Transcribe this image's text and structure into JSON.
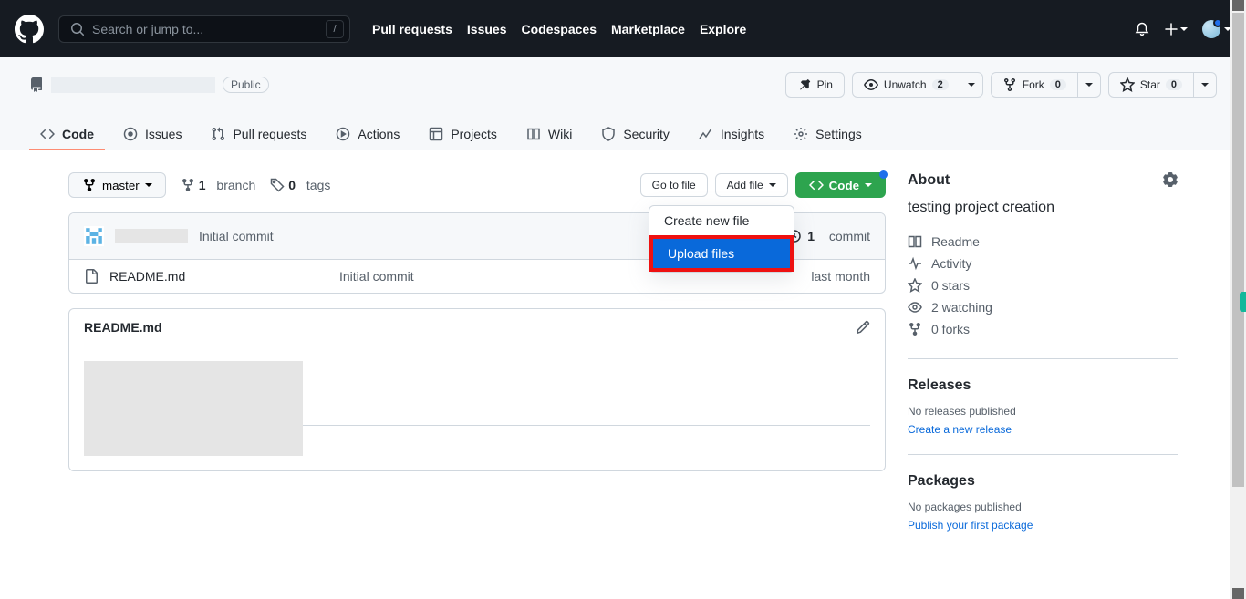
{
  "topbar": {
    "search_placeholder": "Search or jump to...",
    "nav": [
      "Pull requests",
      "Issues",
      "Codespaces",
      "Marketplace",
      "Explore"
    ]
  },
  "repo": {
    "visibility": "Public",
    "actions": {
      "pin": "Pin",
      "unwatch": "Unwatch",
      "unwatch_count": "2",
      "fork": "Fork",
      "fork_count": "0",
      "star": "Star",
      "star_count": "0"
    },
    "tabs": [
      "Code",
      "Issues",
      "Pull requests",
      "Actions",
      "Projects",
      "Wiki",
      "Security",
      "Insights",
      "Settings"
    ]
  },
  "file_nav": {
    "branch_label": "master",
    "branch_count": "1",
    "branch_word": "branch",
    "tag_count": "0",
    "tag_word": "tags",
    "go_to_file": "Go to file",
    "add_file": "Add file",
    "code": "Code",
    "dropdown": {
      "create": "Create new file",
      "upload": "Upload files"
    }
  },
  "commit": {
    "message": "Initial commit",
    "count": "1",
    "count_word": "commit"
  },
  "files": [
    {
      "name": "README.md",
      "msg": "Initial commit",
      "time": "last month"
    }
  ],
  "readme": {
    "title": "README.md"
  },
  "about": {
    "heading": "About",
    "description": "testing project creation",
    "links": {
      "readme": "Readme",
      "activity": "Activity",
      "stars": "0 stars",
      "watching": "2 watching",
      "forks": "0 forks"
    }
  },
  "releases": {
    "heading": "Releases",
    "none": "No releases published",
    "create": "Create a new release"
  },
  "packages": {
    "heading": "Packages",
    "none": "No packages published",
    "publish": "Publish your first package"
  }
}
